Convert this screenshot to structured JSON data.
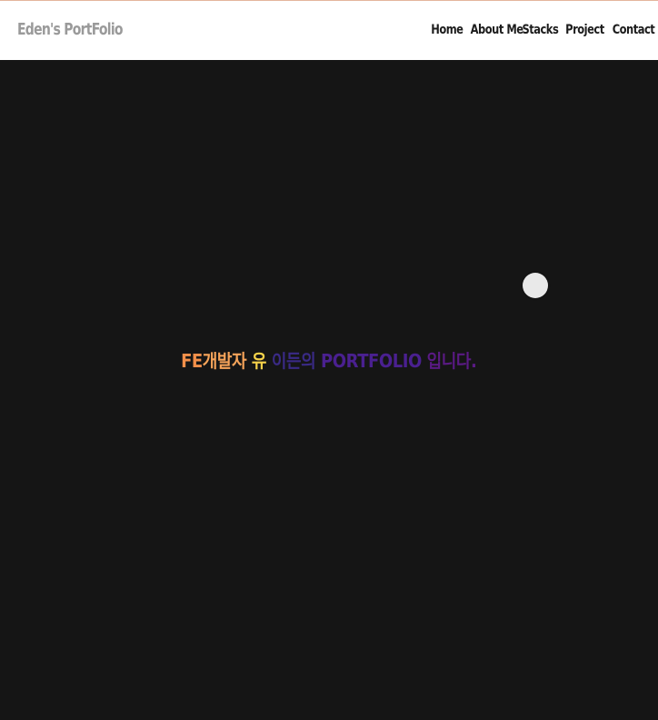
{
  "header": {
    "brand": "Eden's PortFolio",
    "nav": [
      "Home",
      "About Me",
      "Stacks",
      "Project",
      "Contact"
    ]
  },
  "hero": {
    "fe": "FE",
    "dev": "개발자",
    "yu": "유",
    "name": "이든의",
    "portfolio": "PORTFOLIO",
    "end": "입니다."
  },
  "colors": {
    "background": "#151515",
    "header_bg": "#ffffff",
    "brand": "#9a9a9a",
    "nav": "#1c1c1c",
    "hero_fe": "#f4904a",
    "hero_dev": "#f6a45a",
    "hero_yu": "#f6d24a",
    "hero_name": "#3a2a86",
    "hero_portfolio": "#4a2090",
    "hero_end": "#5a1a84"
  }
}
